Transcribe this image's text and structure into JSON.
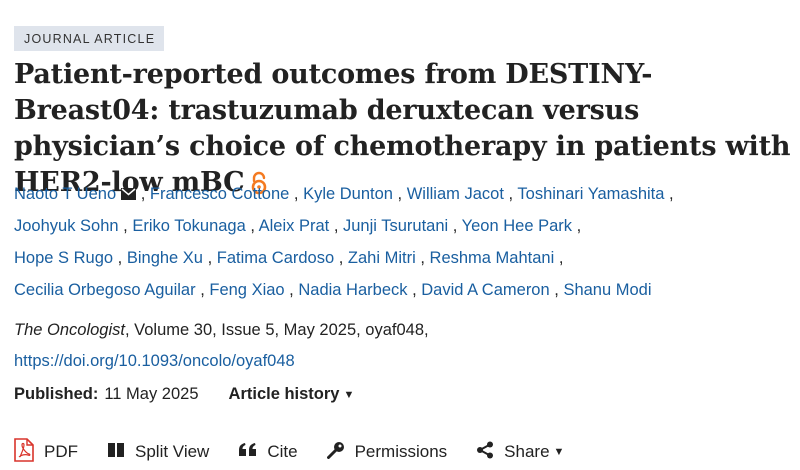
{
  "article_type": "JOURNAL ARTICLE",
  "title": "Patient-reported outcomes from DESTINY-Breast04: trastuzumab deruxtecan versus physician’s choice of chemotherapy in patients with HER2-low mBC",
  "authors": [
    "Naoto T Ueno",
    "Francesco Cottone",
    "Kyle Dunton",
    "William Jacot",
    "Toshinari Yamashita",
    "Joohyuk Sohn",
    "Eriko Tokunaga",
    "Aleix Prat",
    "Junji Tsurutani",
    "Yeon Hee Park",
    "Hope S Rugo",
    "Binghe Xu",
    "Fatima Cardoso",
    "Zahi Mitri",
    "Reshma Mahtani",
    "Cecilia Orbegoso Aguilar",
    "Feng Xiao",
    "Nadia Harbeck",
    "David A Cameron",
    "Shanu Modi"
  ],
  "citation": {
    "journal": "The Oncologist",
    "details": ", Volume 30, Issue 5, May 2025, oyaf048,",
    "doi": "https://doi.org/10.1093/oncolo/oyaf048"
  },
  "published": {
    "label": "Published:",
    "date": "11 May 2025",
    "history_label": "Article history"
  },
  "toolbar": {
    "pdf": "PDF",
    "split_view": "Split View",
    "cite": "Cite",
    "permissions": "Permissions",
    "share": "Share"
  },
  "icons": {
    "open_access": "open-access-lock-icon",
    "mail": "envelope-icon",
    "pdf": "pdf-icon",
    "split_view": "split-view-icon",
    "cite": "quote-icon",
    "permissions": "key-icon",
    "share": "share-icon"
  },
  "colors": {
    "link": "#1a5fa0",
    "open_access": "#f47a20",
    "pdf_icon": "#d9342b",
    "badge_bg": "#dfe4ec"
  }
}
